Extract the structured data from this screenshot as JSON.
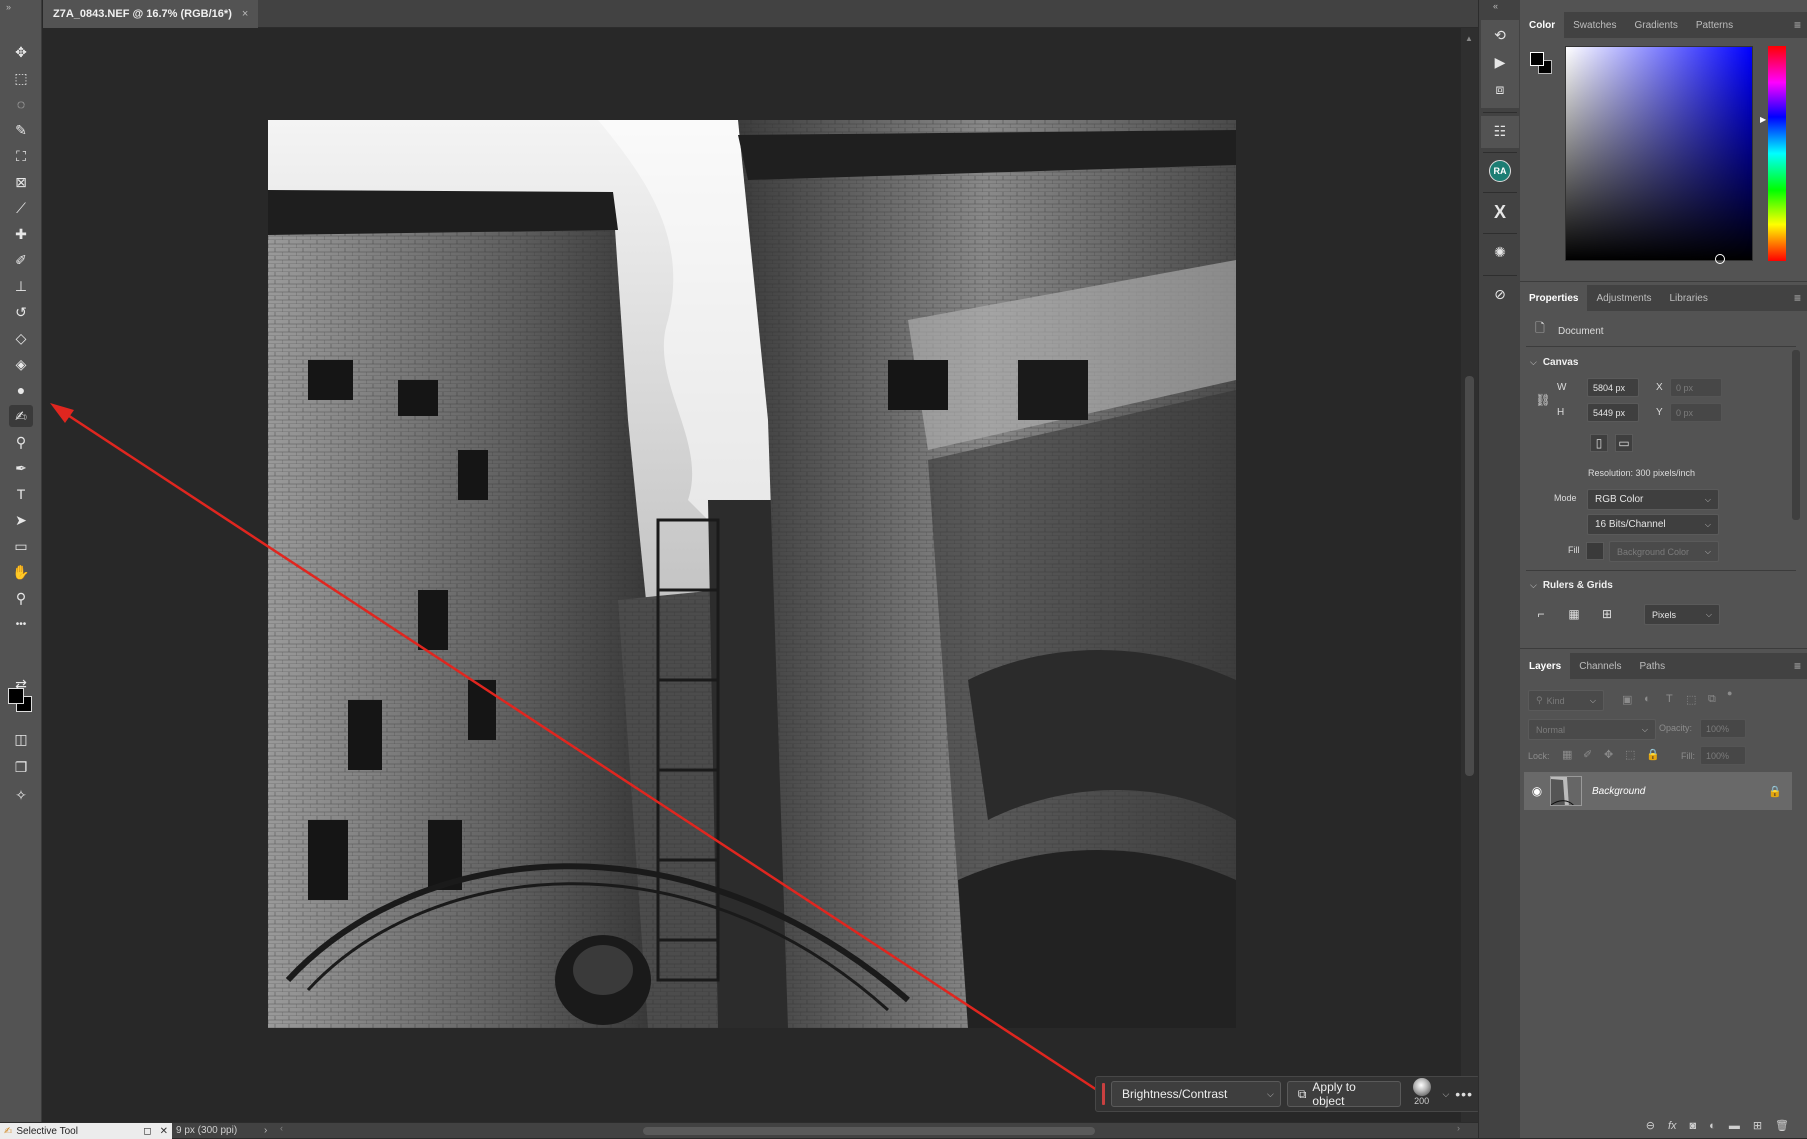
{
  "document_tab": {
    "title": "Z7A_0843.NEF @ 16.7% (RGB/16*)",
    "close": "×"
  },
  "toolbar": {
    "tools": [
      {
        "name": "move-tool",
        "glyph": "✥"
      },
      {
        "name": "marquee-tool",
        "glyph": "⬚"
      },
      {
        "name": "lasso-tool",
        "glyph": "◌"
      },
      {
        "name": "object-selection-tool",
        "glyph": "✎"
      },
      {
        "name": "crop-tool",
        "glyph": "⛶"
      },
      {
        "name": "frame-tool",
        "glyph": "⊠"
      },
      {
        "name": "eyedropper-tool",
        "glyph": "⟋"
      },
      {
        "name": "healing-brush-tool",
        "glyph": "✚"
      },
      {
        "name": "brush-tool",
        "glyph": "✐"
      },
      {
        "name": "clone-stamp-tool",
        "glyph": "⊥"
      },
      {
        "name": "history-brush-tool",
        "glyph": "↺"
      },
      {
        "name": "eraser-tool",
        "glyph": "◇"
      },
      {
        "name": "paint-bucket-tool",
        "glyph": "◈"
      },
      {
        "name": "blur-tool",
        "glyph": "●"
      },
      {
        "name": "selective-tool",
        "glyph": "✍"
      },
      {
        "name": "dodge-tool",
        "glyph": "⚲"
      },
      {
        "name": "pen-tool",
        "glyph": "✒"
      },
      {
        "name": "type-tool",
        "glyph": "T"
      },
      {
        "name": "path-selection-tool",
        "glyph": "➤"
      },
      {
        "name": "rectangle-tool",
        "glyph": "▭"
      },
      {
        "name": "hand-tool",
        "glyph": "✋"
      },
      {
        "name": "zoom-tool",
        "glyph": "⚲"
      },
      {
        "name": "more-tools",
        "glyph": "•••"
      }
    ]
  },
  "status": {
    "tool_tip": "Selective Tool",
    "doc_info": "9 px (300 ppi)"
  },
  "taskbar": {
    "adjustment": "Brightness/Contrast",
    "apply_label": "Apply to object",
    "brush_size": "200"
  },
  "color_panel": {
    "tabs": [
      "Color",
      "Swatches",
      "Gradients",
      "Patterns"
    ],
    "foreground": "#000000",
    "background": "#000000"
  },
  "properties_panel": {
    "tabs": [
      "Properties",
      "Adjustments",
      "Libraries"
    ],
    "type_label": "Document",
    "canvas_heading": "Canvas",
    "w_label": "W",
    "w_value": "5804 px",
    "h_label": "H",
    "h_value": "5449 px",
    "x_label": "X",
    "x_placeholder": "0 px",
    "y_label": "Y",
    "y_placeholder": "0 px",
    "resolution": "Resolution: 300 pixels/inch",
    "mode_label": "Mode",
    "mode_value": "RGB Color",
    "bits_value": "16 Bits/Channel",
    "fill_label": "Fill",
    "fill_value": "Background Color",
    "rulers_heading": "Rulers & Grids",
    "units_value": "Pixels"
  },
  "layers_panel": {
    "tabs": [
      "Layers",
      "Channels",
      "Paths"
    ],
    "kind_placeholder": "Kind",
    "blend_mode": "Normal",
    "opacity_label": "Opacity:",
    "opacity_value": "100%",
    "lock_label": "Lock:",
    "fill_label": "Fill:",
    "fill_value": "100%",
    "layers": [
      {
        "name": "Background",
        "visible": true,
        "locked": true
      }
    ]
  },
  "colors": {
    "annotation_arrow": "#e0261f",
    "accent_badge": "#1c7d73"
  },
  "strip_badge": "RA"
}
